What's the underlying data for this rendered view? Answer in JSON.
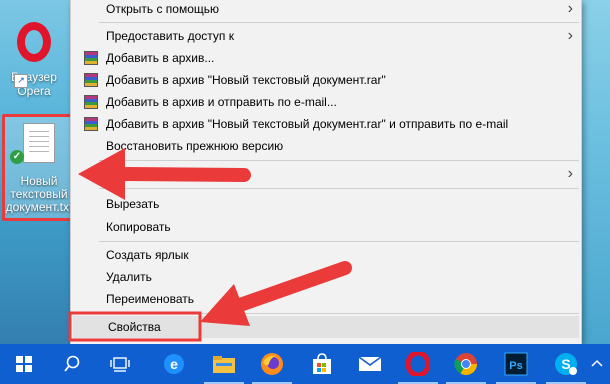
{
  "desktop": {
    "opera_label_line1": "Браузер",
    "opera_label_line2": "Opera",
    "file_label_line1": "Новый",
    "file_label_line2": "текстовый",
    "file_label_line3": "документ.txt"
  },
  "context_menu": {
    "items": [
      {
        "label": "Открыть с помощью"
      },
      {
        "label": "Предоставить доступ к"
      },
      {
        "label": "Добавить в архив..."
      },
      {
        "label": "Добавить в архив \"Новый текстовый документ.rar\""
      },
      {
        "label": "Добавить в архив и отправить по e-mail..."
      },
      {
        "label": "Добавить в архив \"Новый текстовый документ.rar\" и отправить по e-mail"
      },
      {
        "label": "Восстановить прежнюю версию"
      },
      {
        "label": ""
      },
      {
        "label": "Вырезать"
      },
      {
        "label": "Копировать"
      },
      {
        "label": "Создать ярлык"
      },
      {
        "label": "Удалить"
      },
      {
        "label": "Переименовать"
      },
      {
        "label": "Свойства"
      }
    ]
  },
  "taskbar": {
    "icons": [
      "windows-start-icon",
      "search-icon",
      "task-view-icon",
      "edge-icon",
      "file-explorer-icon",
      "firefox-icon",
      "store-icon",
      "mail-icon",
      "opera-icon",
      "chrome-icon",
      "photoshop-icon",
      "skype-icon",
      "notification-icon"
    ],
    "photoshop_text": "Ps",
    "skype_text": "S"
  },
  "colors": {
    "taskbar": "#0f5fd0",
    "annotation_red": "#ea3a3a",
    "menu_bg": "#f2f2f2"
  }
}
